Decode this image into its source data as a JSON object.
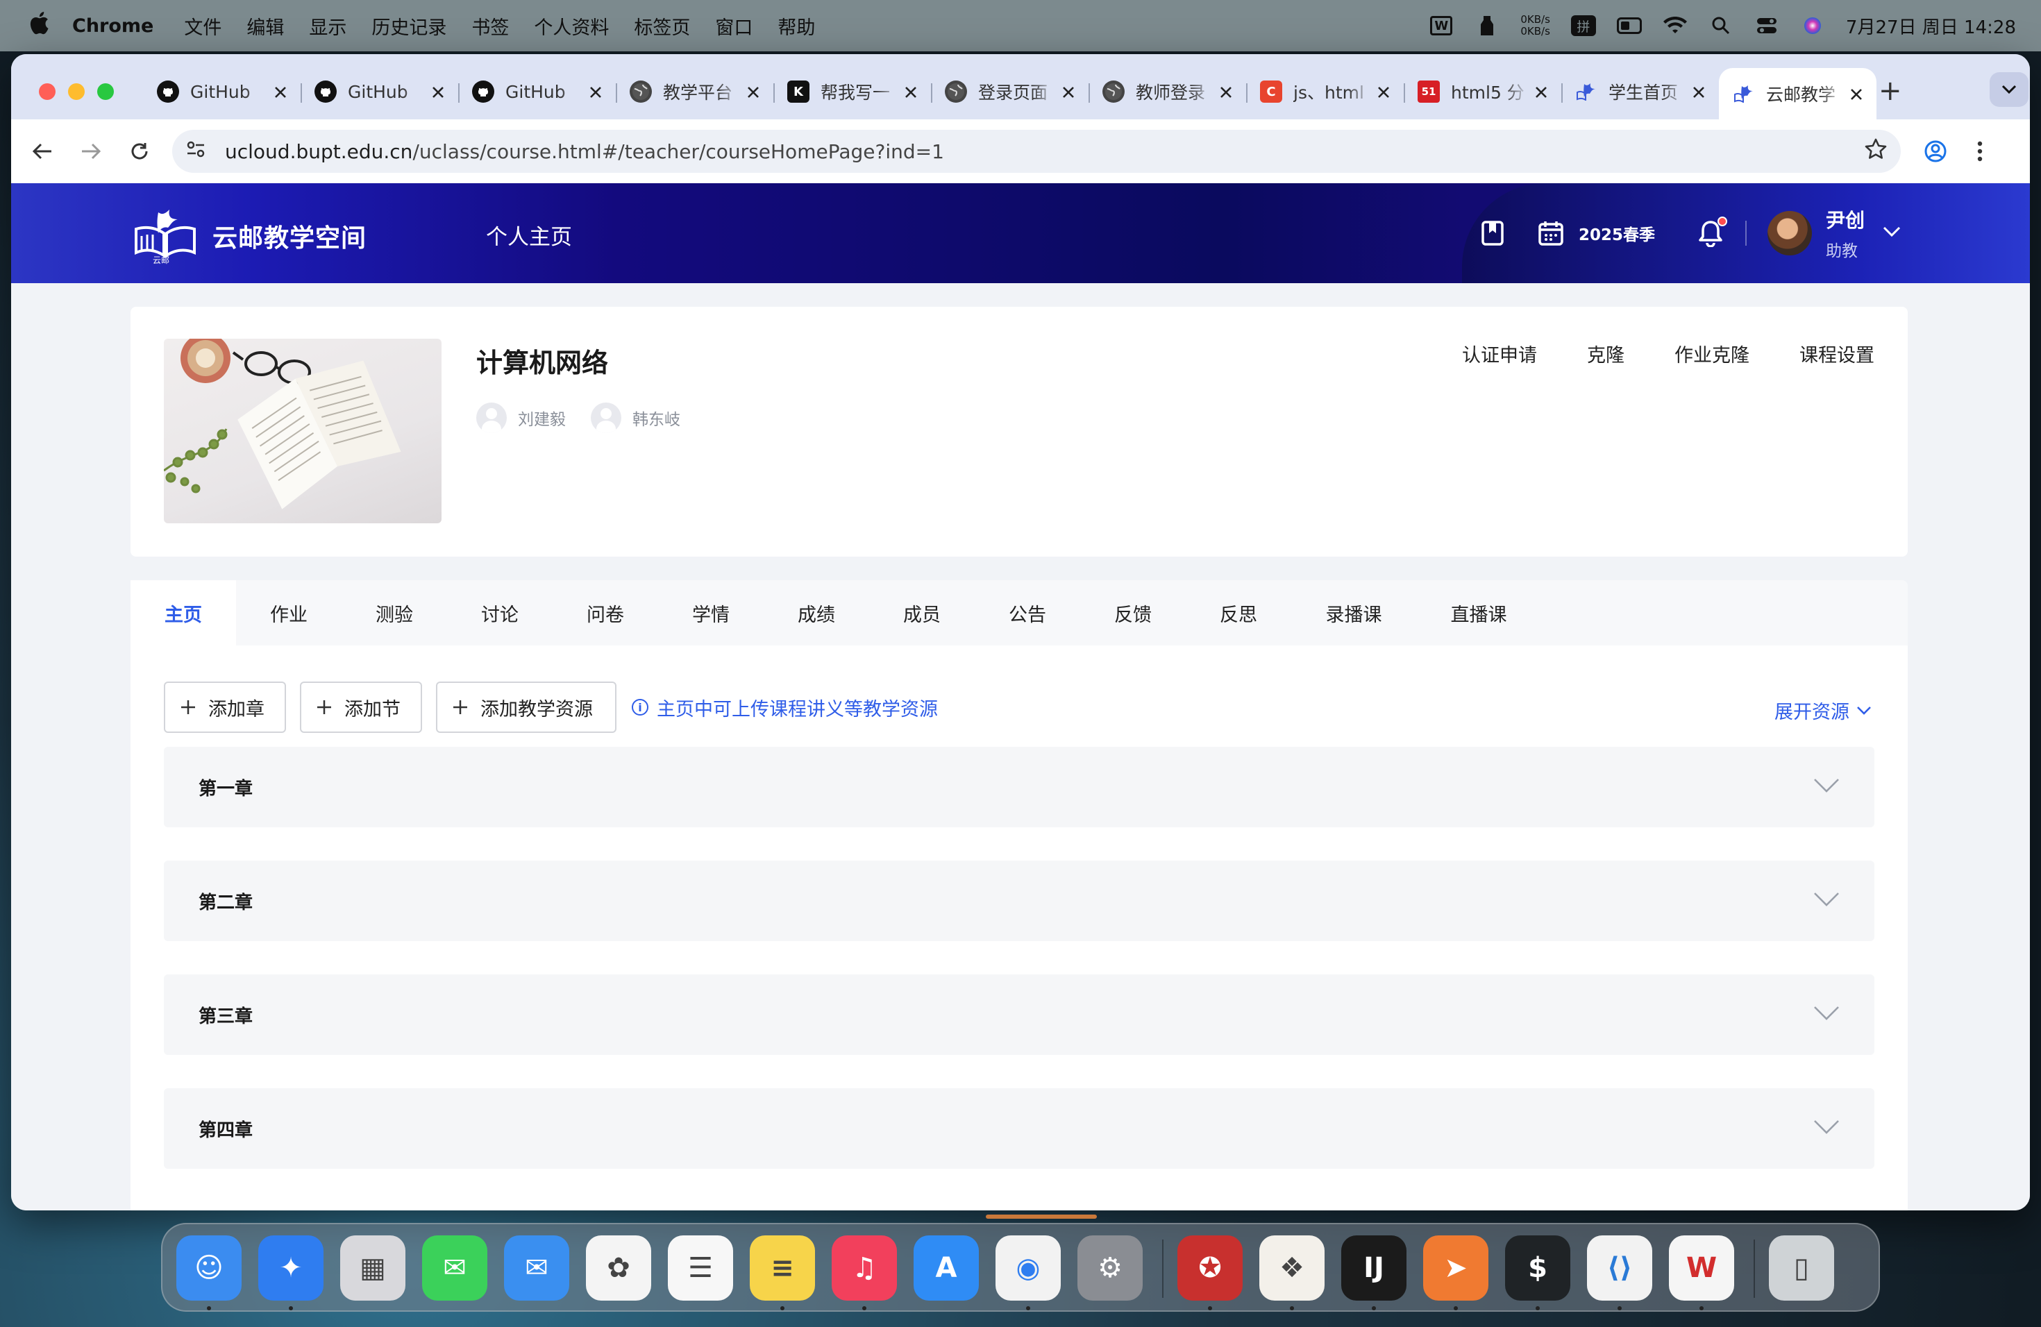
{
  "menubar": {
    "app_name": "Chrome",
    "items": [
      "文件",
      "编辑",
      "显示",
      "历史记录",
      "书签",
      "个人资料",
      "标签页",
      "窗口",
      "帮助"
    ],
    "net_up": "0KB/s",
    "net_down": "0KB/s",
    "ime_label": "拼",
    "wps_label": "W",
    "datetime": "7月27日 周日  14:28"
  },
  "browser": {
    "tabs": [
      {
        "title": "GitHub",
        "icon": "github-icon",
        "color": "#111111"
      },
      {
        "title": "GitHub",
        "icon": "github-icon",
        "color": "#111111"
      },
      {
        "title": "GitHub",
        "icon": "github-icon",
        "color": "#111111"
      },
      {
        "title": "教学平台",
        "icon": "globe-icon",
        "color": "#444444"
      },
      {
        "title": "帮我写一",
        "icon": "k-icon",
        "color": "#111111"
      },
      {
        "title": "登录页面",
        "icon": "globe-icon",
        "color": "#444444"
      },
      {
        "title": "教师登录",
        "icon": "globe-icon",
        "color": "#444444"
      },
      {
        "title": "js、html",
        "icon": "csdn-icon",
        "color": "#e8442e"
      },
      {
        "title": "html5 分",
        "icon": "51cto-icon",
        "color": "#d71f26"
      },
      {
        "title": "学生首页",
        "icon": "cloud-icon",
        "color": "#3a5ad9"
      },
      {
        "title": "云邮教学",
        "icon": "cloud-icon",
        "color": "#3a5ad9"
      }
    ],
    "active_tab_index": 10,
    "url_host": "ucloud.bupt.edu.cn",
    "url_path": "/uclass/course.html#/teacher/courseHomePage?ind=1"
  },
  "site": {
    "logo_text": "云邮教学空间",
    "logo_sub": "云邮",
    "nav_home": "个人主页",
    "season": "2025春季",
    "user_name": "尹创",
    "user_role": "助教"
  },
  "course": {
    "title": "计算机网络",
    "teachers": [
      "刘建毅",
      "韩东岐"
    ],
    "actions": [
      "认证申请",
      "克隆",
      "作业克隆",
      "课程设置"
    ]
  },
  "tabs": {
    "items": [
      "主页",
      "作业",
      "测验",
      "讨论",
      "问卷",
      "学情",
      "成绩",
      "成员",
      "公告",
      "反馈",
      "反思",
      "录播课",
      "直播课"
    ],
    "active": "主页"
  },
  "toolbar": {
    "add_chapter": "添加章",
    "add_section": "添加节",
    "add_resource": "添加教学资源",
    "hint": "主页中可上传课程讲义等教学资源",
    "expand": "展开资源"
  },
  "chapters": [
    "第一章",
    "第二章",
    "第三章",
    "第四章"
  ],
  "dock": [
    {
      "name": "finder-icon",
      "color": "#3b8cf0",
      "running": true
    },
    {
      "name": "safari-icon",
      "color": "#2f7df0",
      "running": true
    },
    {
      "name": "launchpad-icon",
      "color": "#d8d8dc",
      "running": false
    },
    {
      "name": "messages-icon",
      "color": "#3bd15a",
      "running": false
    },
    {
      "name": "mail-icon",
      "color": "#3a8ff0",
      "running": false
    },
    {
      "name": "photos-icon",
      "color": "#f4f4f4",
      "running": false
    },
    {
      "name": "reminders-icon",
      "color": "#f7f7f7",
      "running": false
    },
    {
      "name": "notes-icon",
      "color": "#f7d44a",
      "running": true
    },
    {
      "name": "music-icon",
      "color": "#f2405c",
      "running": true
    },
    {
      "name": "app-store-icon",
      "color": "#2f8cf5",
      "running": false
    },
    {
      "name": "chrome-icon",
      "color": "#f2f2f2",
      "running": true
    },
    {
      "name": "system-settings-icon",
      "color": "#8a8d93",
      "running": false
    },
    {
      "name": "wps-pdf-icon",
      "color": "#c8302e",
      "running": true
    },
    {
      "name": "dbeaver-icon",
      "color": "#f3f0ea",
      "running": true
    },
    {
      "name": "intellij-icon",
      "color": "#1b1b1b",
      "running": true
    },
    {
      "name": "postman-icon",
      "color": "#f07a31",
      "running": true
    },
    {
      "name": "terminal-icon",
      "color": "#1f2326",
      "running": true
    },
    {
      "name": "vscode-icon",
      "color": "#f2f2f2",
      "running": true
    },
    {
      "name": "wps-office-icon",
      "color": "#f5f5f5",
      "running": true
    },
    {
      "name": "trash-icon",
      "color": "#cfd3d6",
      "running": false
    }
  ]
}
